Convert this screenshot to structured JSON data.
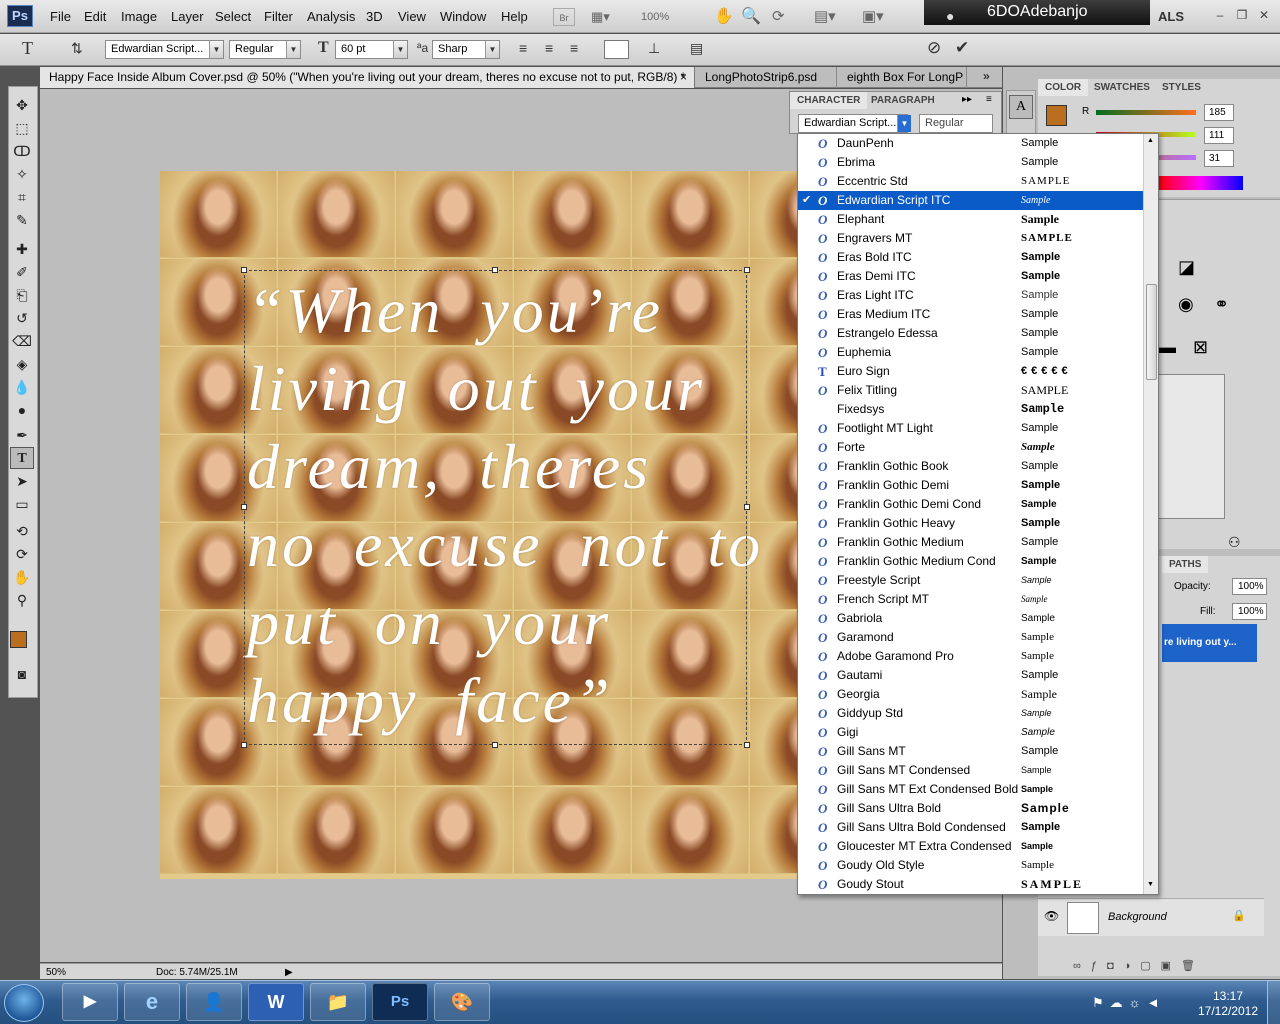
{
  "app": {
    "logo": "Ps",
    "user": "6DOAdebanjo",
    "workspace": "ALS",
    "zoom_menu": "100%"
  },
  "menu": [
    "File",
    "Edit",
    "Image",
    "Layer",
    "Select",
    "Filter",
    "Analysis",
    "3D",
    "View",
    "Window",
    "Help"
  ],
  "options": {
    "font_family": "Edwardian Script...",
    "font_style": "Regular",
    "font_size": "60 pt",
    "antialias": "Sharp"
  },
  "tabs": [
    {
      "label": "Happy Face Inside Album Cover.psd @ 50% (\"When you're living out your dream, theres no excuse not to put, RGB/8) *"
    },
    {
      "label": "LongPhotoStrip6.psd"
    },
    {
      "label": "eighth Box For LongP"
    }
  ],
  "canvas": {
    "quote_lines": [
      "“When you’re",
      "living out your",
      "dream, theres",
      "no excuse not to",
      "put on your",
      "happy face”"
    ]
  },
  "status": {
    "zoom": "50%",
    "doc": "Doc: 5.74M/25.1M"
  },
  "character_panel": {
    "tab_character": "CHARACTER",
    "tab_paragraph": "PARAGRAPH",
    "font_family": "Edwardian Script...",
    "font_style": "Regular"
  },
  "color_panel": {
    "tab_color": "COLOR",
    "tab_swatches": "SWATCHES",
    "tab_styles": "STYLES",
    "r": "185",
    "g": "111",
    "b": "31",
    "r_label": "R",
    "foreground": "#b96f1f"
  },
  "layers_panel": {
    "tab_paths": "PATHS",
    "opacity_label": "Opacity:",
    "opacity": "100%",
    "fill_label": "Fill:",
    "fill": "100%",
    "text_layer": "re living out y...",
    "background_layer": "Background"
  },
  "font_list": [
    {
      "name": "DaunPenh",
      "sample": "Sample"
    },
    {
      "name": "Ebrima",
      "sample": "Sample"
    },
    {
      "name": "Eccentric Std",
      "sample": "SAMPLE"
    },
    {
      "name": "Edwardian Script ITC",
      "sample": "Sample",
      "selected": true
    },
    {
      "name": "Elephant",
      "sample": "Sample"
    },
    {
      "name": "Engravers MT",
      "sample": "SAMPLE"
    },
    {
      "name": "Eras Bold ITC",
      "sample": "Sample"
    },
    {
      "name": "Eras Demi ITC",
      "sample": "Sample"
    },
    {
      "name": "Eras Light ITC",
      "sample": "Sample"
    },
    {
      "name": "Eras Medium ITC",
      "sample": "Sample"
    },
    {
      "name": "Estrangelo Edessa",
      "sample": "Sample"
    },
    {
      "name": "Euphemia",
      "sample": "Sample"
    },
    {
      "name": "Euro Sign",
      "sample": "€€€€€",
      "icon": "T"
    },
    {
      "name": "Felix Titling",
      "sample": "SAMPLE"
    },
    {
      "name": "Fixedsys",
      "sample": "Sample",
      "icon": ""
    },
    {
      "name": "Footlight MT Light",
      "sample": "Sample"
    },
    {
      "name": "Forte",
      "sample": "Sample"
    },
    {
      "name": "Franklin Gothic Book",
      "sample": "Sample"
    },
    {
      "name": "Franklin Gothic Demi",
      "sample": "Sample"
    },
    {
      "name": "Franklin Gothic Demi Cond",
      "sample": "Sample"
    },
    {
      "name": "Franklin Gothic Heavy",
      "sample": "Sample"
    },
    {
      "name": "Franklin Gothic Medium",
      "sample": "Sample"
    },
    {
      "name": "Franklin Gothic Medium Cond",
      "sample": "Sample"
    },
    {
      "name": "Freestyle Script",
      "sample": "Sample"
    },
    {
      "name": "French Script MT",
      "sample": "Sample"
    },
    {
      "name": "Gabriola",
      "sample": "Sample"
    },
    {
      "name": "Garamond",
      "sample": "Sample"
    },
    {
      "name": "Adobe Garamond Pro",
      "sample": "Sample"
    },
    {
      "name": "Gautami",
      "sample": "Sample"
    },
    {
      "name": "Georgia",
      "sample": "Sample"
    },
    {
      "name": "Giddyup Std",
      "sample": "Sample"
    },
    {
      "name": "Gigi",
      "sample": "Sample"
    },
    {
      "name": "Gill Sans MT",
      "sample": "Sample"
    },
    {
      "name": "Gill Sans MT Condensed",
      "sample": "Sample"
    },
    {
      "name": "Gill Sans MT Ext Condensed Bold",
      "sample": "Sample"
    },
    {
      "name": "Gill Sans Ultra Bold",
      "sample": "Sample"
    },
    {
      "name": "Gill Sans Ultra Bold Condensed",
      "sample": "Sample"
    },
    {
      "name": "Gloucester MT Extra Condensed",
      "sample": "Sample"
    },
    {
      "name": "Goudy Old Style",
      "sample": "Sample"
    },
    {
      "name": "Goudy Stout",
      "sample": "SAMPLE"
    }
  ],
  "taskbar": {
    "time": "13:17",
    "date": "17/12/2012",
    "apps": [
      "W",
      "Ps"
    ]
  }
}
